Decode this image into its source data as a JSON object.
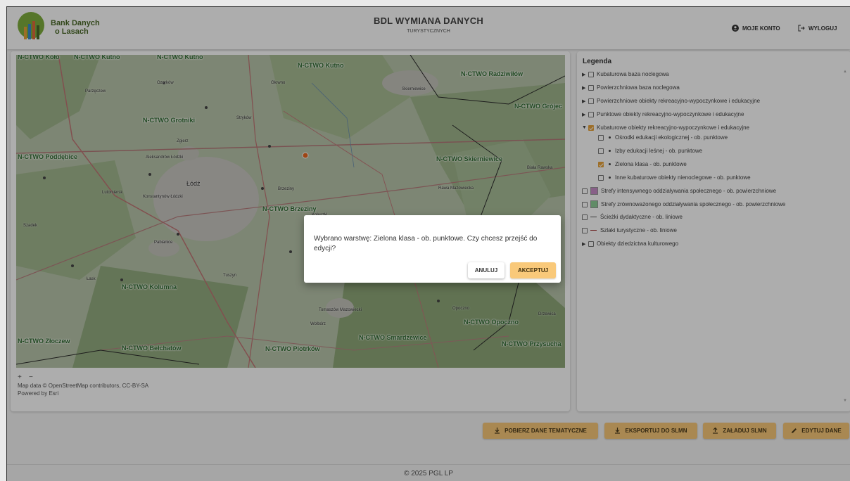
{
  "header": {
    "logo_line1": "Bank Danych",
    "logo_line2": "o Lasach",
    "title": "BDL WYMIANA DANYCH",
    "subtitle": "TURYSTYCZNYCH",
    "account_label": "MOJE KONTO",
    "logout_label": "WYLOGUJ"
  },
  "map": {
    "labels": {
      "kolo": "N-CTWO Koło",
      "kutno1": "N-CTWO Kutno",
      "kutno2": "N-CTWO Kutno",
      "kutno3": "N-CTWO Kutno",
      "radziwillow": "N-CTWO Radziwiłów",
      "grojec": "N-CTWO Grójec",
      "grotniki": "N-CTWO Grotniki",
      "poddebice": "N-CTWO Poddębice",
      "skierniewice": "N-CTWO Skierniewice",
      "brzeziny": "N-CTWO Brzeziny",
      "kolumna": "N-CTWO Kolumna",
      "opoczno": "N-CTWO Opoczno",
      "zloczew": "N-CTWO Złoczew",
      "belchatow": "N-CTWO Bełchatów",
      "piotrkow": "N-CTWO Piotrków",
      "smardzewice": "N-CTWO Smardzewice",
      "przysucha": "N-CTWO Przysucha"
    },
    "towns": {
      "lodz": "Łódź",
      "skierniewice": "Skierniewice",
      "rawa": "Rawa Mazowiecka",
      "tomaszow": "Tomaszów Mazowiecki",
      "pabianice": "Pabianice",
      "zgierz": "Zgierz",
      "brzeziny": "Brzeziny",
      "lask": "Łask",
      "tuszyn": "Tuszyn",
      "parzeczew": "Parzęczew",
      "ozorkow": "Ozorków",
      "strykow": "Stryków",
      "glowno": "Głowno",
      "koluszki": "Koluszki",
      "biala_rawska": "Biała Rawska",
      "lutomiersk": "Lutomiersk",
      "konstantynow": "Konstantynów Łódzki",
      "aleksandrow": "Aleksandrów Łódzki",
      "wolbórz": "Wolbórz",
      "szadek": "Szadek",
      "opoczno": "Opoczno",
      "drzewica": "Drzewica"
    },
    "zoom_in": "+",
    "zoom_out": "−",
    "attribution_line1": "Map data © OpenStreetMap contributors, CC-BY-SA",
    "attribution_line2": "Powered by Esri"
  },
  "legend": {
    "title": "Legenda",
    "items": [
      {
        "label": "Kubaturowa baza noclegowa"
      },
      {
        "label": "Powierzchniowa baza noclegowa"
      },
      {
        "label": "Powierzchniowe obiekty rekreacyjno-wypoczynkowe i edukacyjne"
      },
      {
        "label": "Punktowe obiekty rekreacyjno-wypoczynkowe i edukacyjne"
      },
      {
        "label": "Kubaturowe obiekty rekreacyjno-wypoczynkowe i edukacyjne"
      },
      {
        "label": "Ośrodki edukacji ekologicznej - ob. punktowe"
      },
      {
        "label": "Izby edukacji leśnej - ob. punktowe"
      },
      {
        "label": "Zielona klasa - ob. punktowe"
      },
      {
        "label": "Inne kubaturowe obiekty nienoclegowe - ob. punktowe"
      },
      {
        "label": "Strefy intensywnego oddziaływania społecznego - ob. powierzchniowe",
        "color": "#c98ec9"
      },
      {
        "label": "Strefy zrównoważonego oddziaływania społecznego - ob. powierzchniowe",
        "color": "#8fcf98"
      },
      {
        "label": "Ścieżki dydaktyczne - ob. liniowe",
        "color": "#555555"
      },
      {
        "label": "Szlaki turystyczne - ob. liniowe",
        "color": "#a33a3a"
      },
      {
        "label": "Obiekty dziedzictwa kulturowego"
      }
    ]
  },
  "actions": {
    "download": "POBIERZ DANE TEMATYCZNE",
    "export": "EKSPORTUJ DO SLMN",
    "upload": "ZAŁADUJ SLMN",
    "edit": "EDYTUJ DANE"
  },
  "footer": "© 2025 PGL LP",
  "dialog": {
    "message": "Wybrano warstwę: Zielona klasa - ob. punktowe. Czy chcesz przejść do edycji?",
    "cancel": "ANULUJ",
    "accept": "AKCEPTUJ"
  },
  "colors": {
    "accent": "#f9c97a",
    "checkbox": "#e8a33a",
    "brand_green": "#4c6b2a",
    "selected_point": "#e8661e"
  }
}
